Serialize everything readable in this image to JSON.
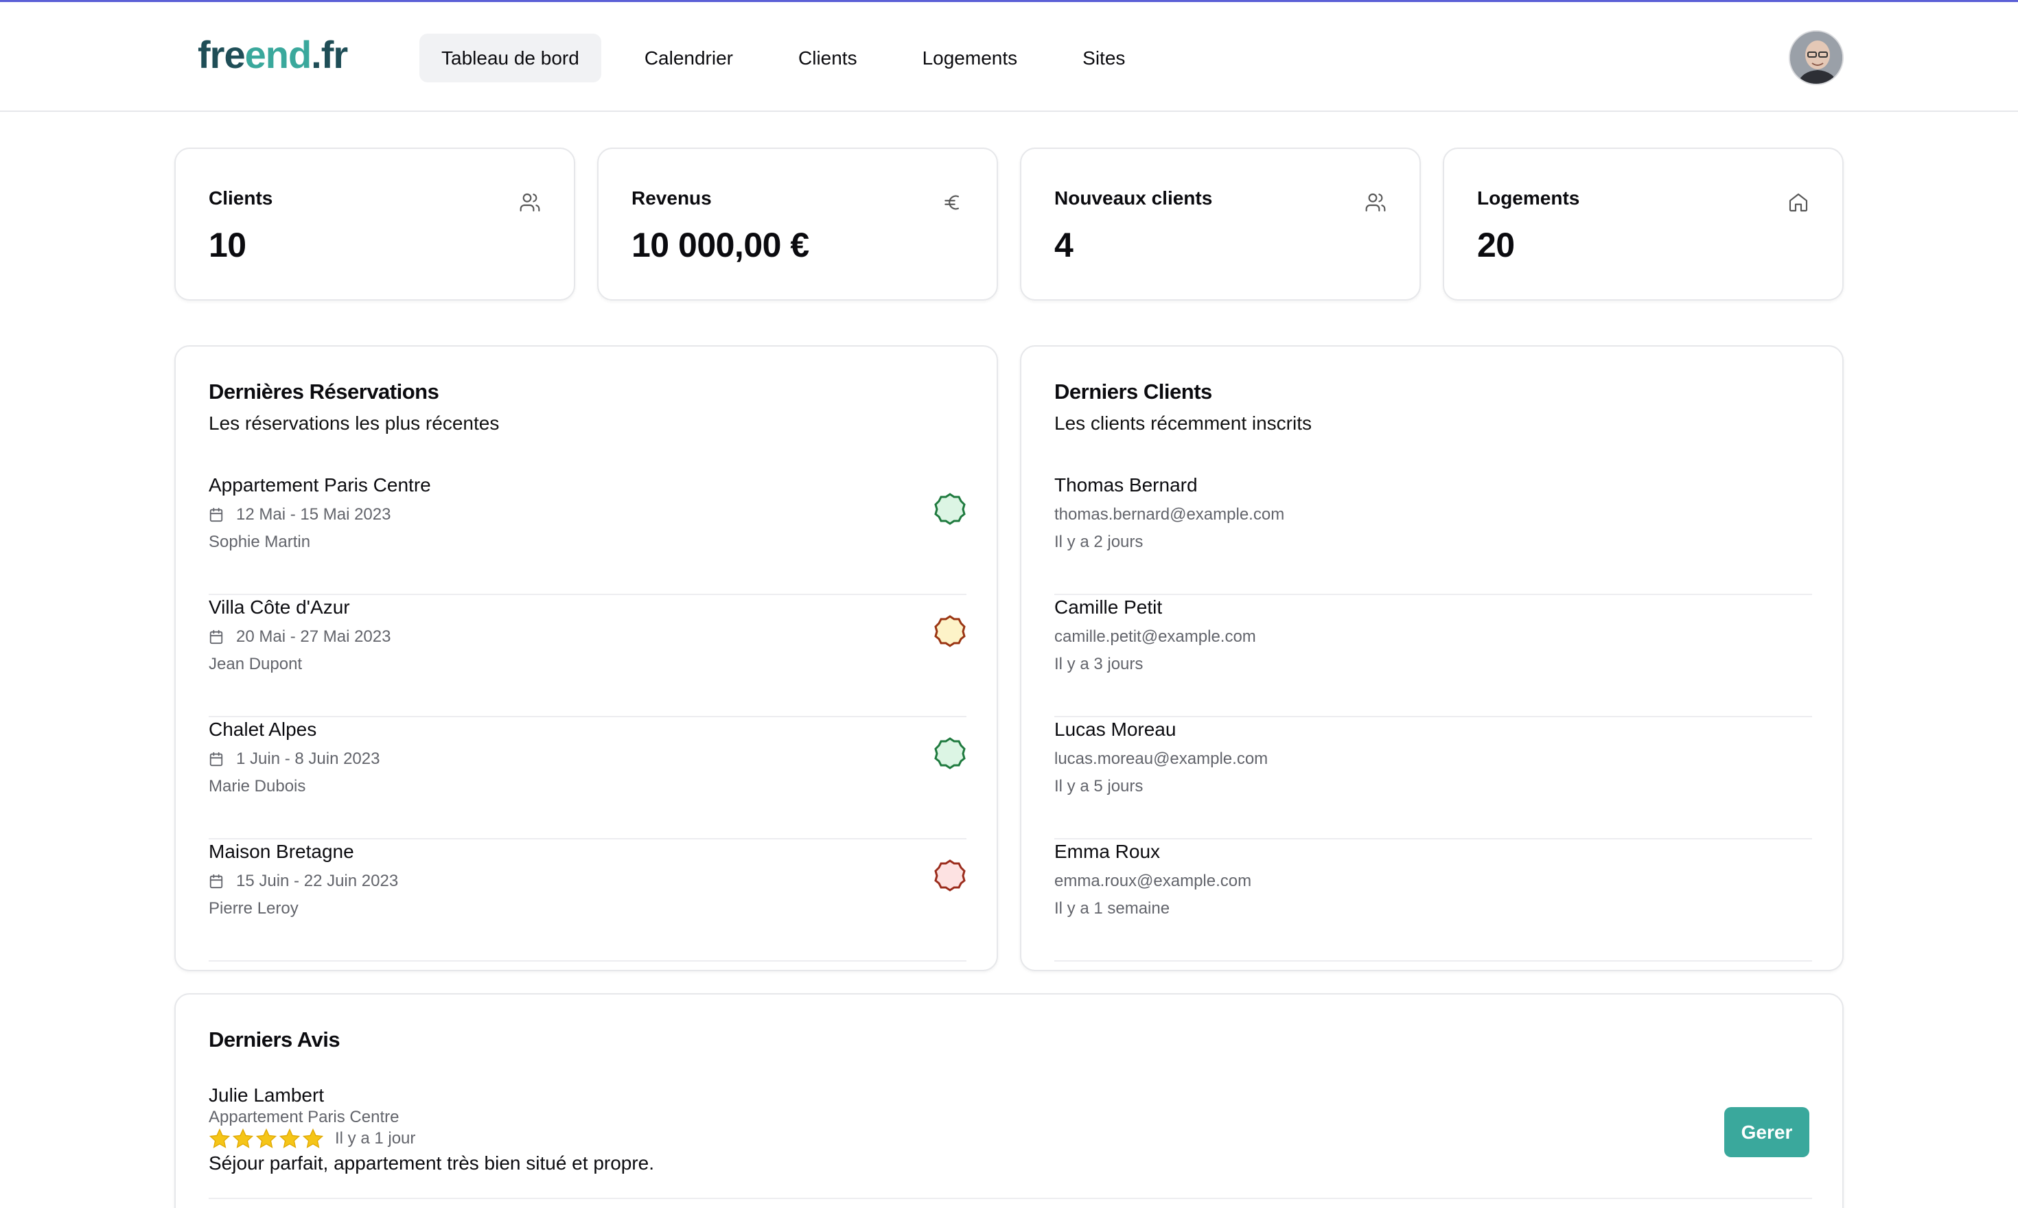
{
  "logo": {
    "part1": "fre",
    "part2": "end",
    "part3": ".fr"
  },
  "nav": {
    "items": [
      {
        "label": "Tableau de bord",
        "active": true
      },
      {
        "label": "Calendrier",
        "active": false
      },
      {
        "label": "Clients",
        "active": false
      },
      {
        "label": "Logements",
        "active": false
      },
      {
        "label": "Sites",
        "active": false
      }
    ]
  },
  "stats": [
    {
      "title": "Clients",
      "value": "10",
      "icon": "users-icon"
    },
    {
      "title": "Revenus",
      "value": "10 000,00 €",
      "icon": "euro-icon"
    },
    {
      "title": "Nouveaux clients",
      "value": "4",
      "icon": "users-icon"
    },
    {
      "title": "Logements",
      "value": "20",
      "icon": "home-icon"
    }
  ],
  "reservations": {
    "title": "Dernières Réservations",
    "subtitle": "Les réservations les plus récentes",
    "items": [
      {
        "name": "Appartement Paris Centre",
        "dates": "12 Mai - 15 Mai 2023",
        "client": "Sophie Martin",
        "status": "confirmed",
        "status_color": "#1e7a3e",
        "status_bg": "#dcf5e4"
      },
      {
        "name": "Villa Côte d'Azur",
        "dates": "20 Mai - 27 Mai 2023",
        "client": "Jean Dupont",
        "status": "pending",
        "status_color": "#9a3412",
        "status_bg": "#fdf3c8"
      },
      {
        "name": "Chalet Alpes",
        "dates": "1 Juin - 8 Juin 2023",
        "client": "Marie Dubois",
        "status": "confirmed",
        "status_color": "#1e7a3e",
        "status_bg": "#dcf5e4"
      },
      {
        "name": "Maison Bretagne",
        "dates": "15 Juin - 22 Juin 2023",
        "client": "Pierre Leroy",
        "status": "cancelled",
        "status_color": "#9b2c1c",
        "status_bg": "#fde2e2"
      }
    ]
  },
  "clients": {
    "title": "Derniers Clients",
    "subtitle": "Les clients récemment inscrits",
    "items": [
      {
        "name": "Thomas Bernard",
        "email": "thomas.bernard@example.com",
        "since": "Il y a 2 jours"
      },
      {
        "name": "Camille Petit",
        "email": "camille.petit@example.com",
        "since": "Il y a 3 jours"
      },
      {
        "name": "Lucas Moreau",
        "email": "lucas.moreau@example.com",
        "since": "Il y a 5 jours"
      },
      {
        "name": "Emma Roux",
        "email": "emma.roux@example.com",
        "since": "Il y a 1 semaine"
      }
    ]
  },
  "reviews": {
    "title": "Derniers Avis",
    "items": [
      {
        "author": "Julie Lambert",
        "property": "Appartement Paris Centre",
        "rating": 5,
        "since": "Il y a 1 jour",
        "text": "Séjour parfait, appartement très bien situé et propre.",
        "action_label": "Gerer"
      }
    ]
  },
  "colors": {
    "accent": "#3aa89c",
    "star": "#f5c518",
    "logo_dark": "#1f4e57"
  }
}
